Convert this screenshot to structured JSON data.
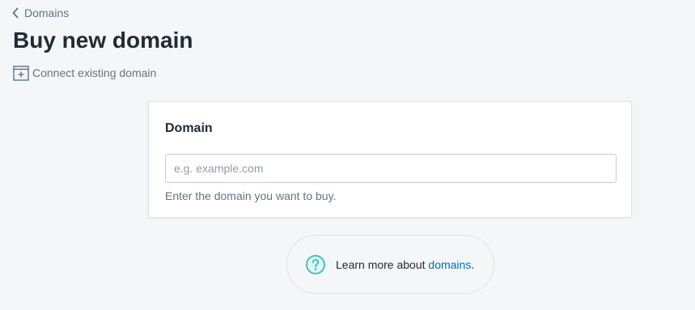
{
  "breadcrumb": {
    "label": "Domains",
    "icon": "chevron-left-icon"
  },
  "page": {
    "title": "Buy new domain"
  },
  "secondary_action": {
    "label": "Connect existing domain",
    "icon": "add-window-icon"
  },
  "domain_card": {
    "title": "Domain",
    "input": {
      "placeholder": "e.g. example.com",
      "value": ""
    },
    "help_text": "Enter the domain you want to buy."
  },
  "footer_help": {
    "icon": "question-circle-icon",
    "text_prefix": "Learn more about ",
    "link_label": "domains",
    "text_suffix": ".",
    "icon_color": "#47c1bf",
    "link_color": "#006fbb"
  }
}
